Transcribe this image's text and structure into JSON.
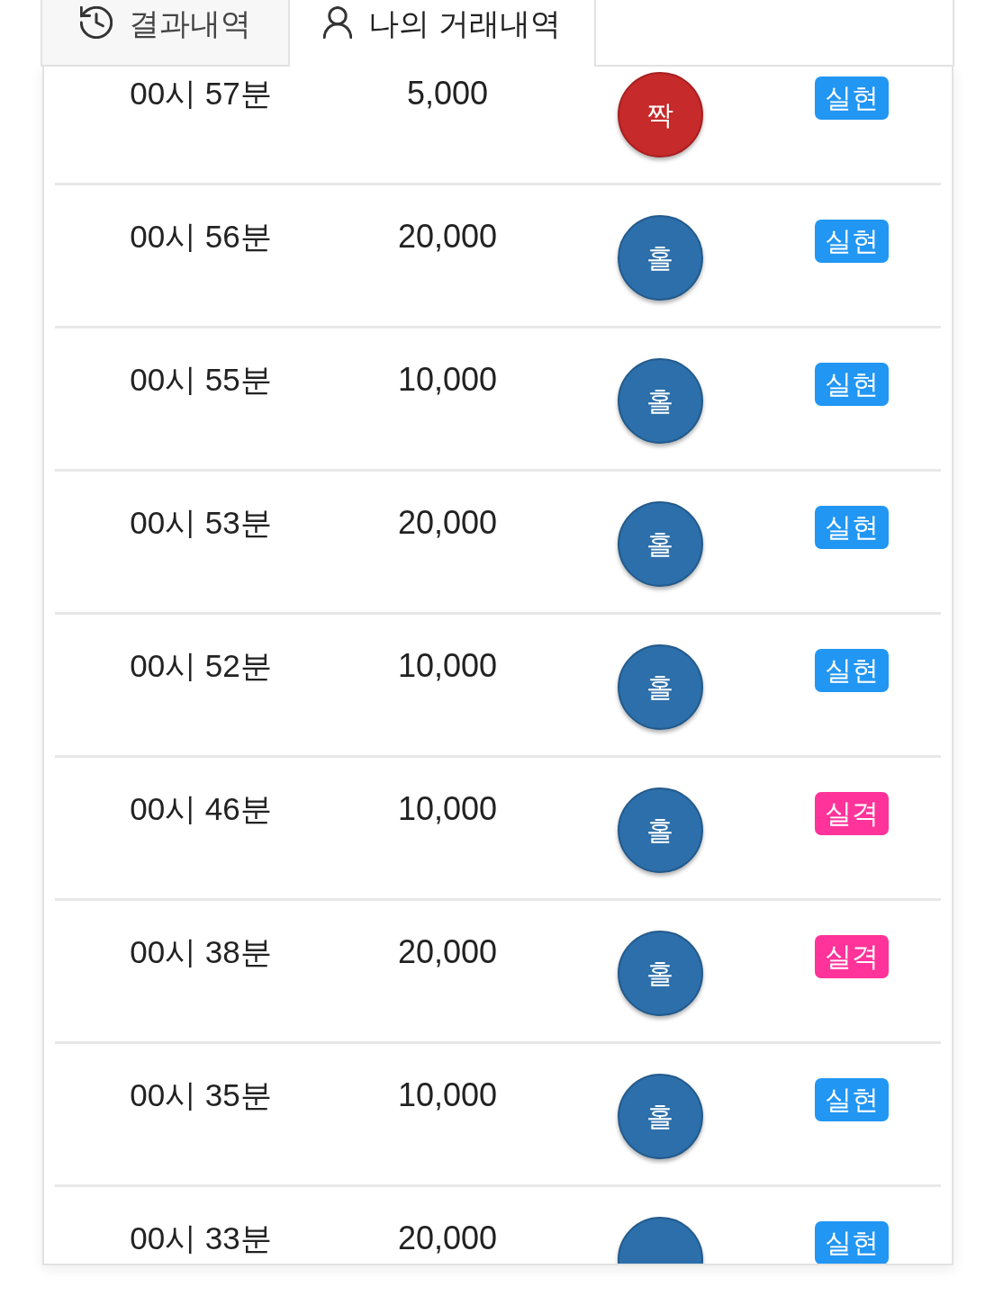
{
  "tabs": [
    {
      "label": "결과내역",
      "selected": false
    },
    {
      "label": "나의 거래내역",
      "selected": true
    }
  ],
  "rows": [
    {
      "time": "00시 57분",
      "amount": "5,000",
      "pick": {
        "kind": "even",
        "label": "짝"
      },
      "result": {
        "kind": "hit",
        "label": "실현"
      }
    },
    {
      "time": "00시 56분",
      "amount": "20,000",
      "pick": {
        "kind": "odd",
        "label": "홀"
      },
      "result": {
        "kind": "hit",
        "label": "실현"
      }
    },
    {
      "time": "00시 55분",
      "amount": "10,000",
      "pick": {
        "kind": "odd",
        "label": "홀"
      },
      "result": {
        "kind": "hit",
        "label": "실현"
      }
    },
    {
      "time": "00시 53분",
      "amount": "20,000",
      "pick": {
        "kind": "odd",
        "label": "홀"
      },
      "result": {
        "kind": "hit",
        "label": "실현"
      }
    },
    {
      "time": "00시 52분",
      "amount": "10,000",
      "pick": {
        "kind": "odd",
        "label": "홀"
      },
      "result": {
        "kind": "hit",
        "label": "실현"
      }
    },
    {
      "time": "00시 46분",
      "amount": "10,000",
      "pick": {
        "kind": "odd",
        "label": "홀"
      },
      "result": {
        "kind": "miss",
        "label": "실격"
      }
    },
    {
      "time": "00시 38분",
      "amount": "20,000",
      "pick": {
        "kind": "odd",
        "label": "홀"
      },
      "result": {
        "kind": "miss",
        "label": "실격"
      }
    },
    {
      "time": "00시 35분",
      "amount": "10,000",
      "pick": {
        "kind": "odd",
        "label": "홀"
      },
      "result": {
        "kind": "hit",
        "label": "실현"
      }
    },
    {
      "time": "00시 33분",
      "amount": "20,000",
      "pick": {
        "kind": "odd"
      },
      "result": {
        "kind": "hit",
        "label": "실현"
      }
    }
  ]
}
